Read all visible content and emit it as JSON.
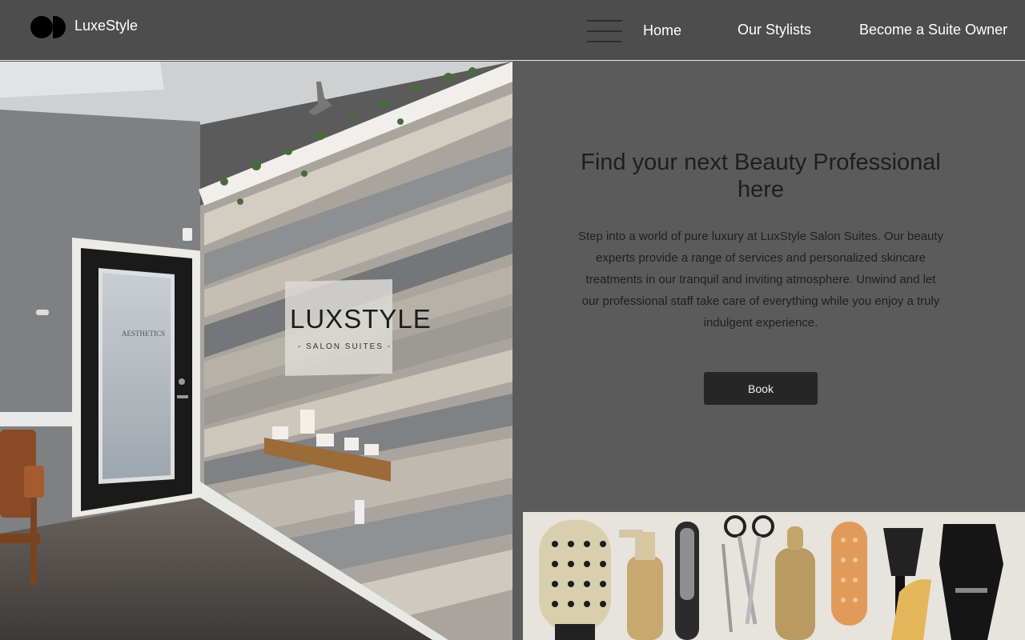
{
  "header": {
    "brand": "LuxeStyle",
    "nav": [
      {
        "label": "Home"
      },
      {
        "label": "Our Stylists"
      },
      {
        "label": "Become a Suite Owner"
      }
    ]
  },
  "hero": {
    "headline": "Find your next Beauty Professional here",
    "intro": "Step into a world of pure luxury at LuxStyle Salon Suites. Our beauty experts provide a range of services and personalized skincare treatments in our tranquil and inviting atmosphere. Unwind and let our professional staff take care of everything while you enjoy a truly indulgent experience.",
    "book_label": "Book"
  },
  "photo": {
    "sign_title": "LUXSTYLE",
    "sign_subtitle": "- SALON SUITES -",
    "door_text": "AESTHETICS"
  },
  "colors": {
    "header_bg": "#4d4d4d",
    "page_bg": "#5b5b5b",
    "button_bg": "#262626"
  }
}
